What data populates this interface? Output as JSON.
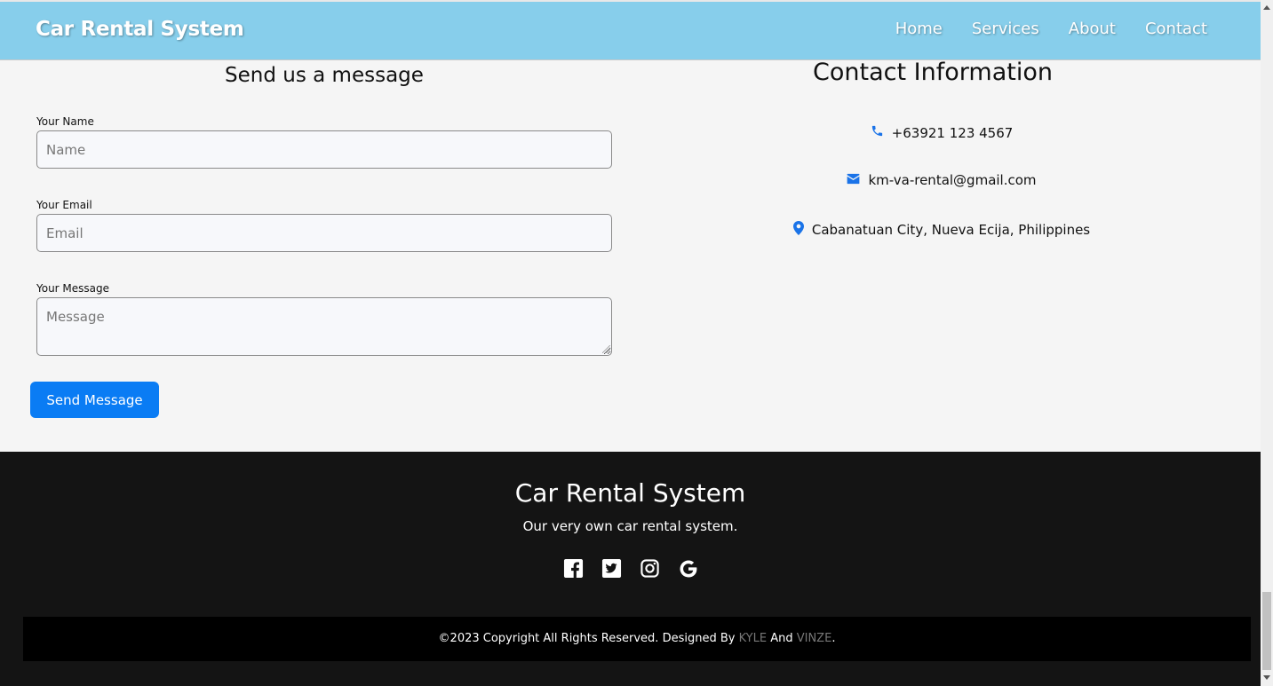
{
  "header": {
    "brand": "Car Rental System",
    "nav": [
      "Home",
      "Services",
      "About",
      "Contact"
    ]
  },
  "form": {
    "title": "Send us a message",
    "name_label": "Your Name",
    "name_placeholder": "Name",
    "email_label": "Your Email",
    "email_placeholder": "Email",
    "message_label": "Your Message",
    "message_placeholder": "Message",
    "submit_label": "Send Message"
  },
  "contact": {
    "title": "Contact Information",
    "phone": "+63921 123 4567",
    "email": "km-va-rental@gmail.com",
    "address": "Cabanatuan City, Nueva Ecija, Philippines"
  },
  "footer": {
    "title": "Car Rental System",
    "subtitle": "Our very own car rental system.",
    "socials": [
      "facebook-icon",
      "twitter-icon",
      "instagram-icon",
      "google-icon"
    ],
    "copyright_prefix": "©2023 Copyright All Rights Reserved. Designed By",
    "designer1": "KYLE",
    "and": "And",
    "designer2": "VINZE",
    "suffix": "."
  },
  "colors": {
    "header_bg": "#87ceeb",
    "button_bg": "#0a7cf4",
    "icon_blue": "#1a73e8",
    "footer_bg": "#141414"
  }
}
